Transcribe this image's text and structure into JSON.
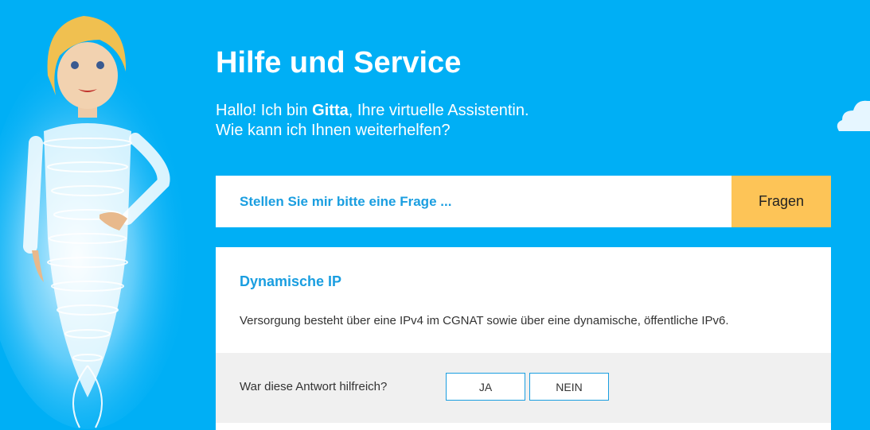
{
  "header": {
    "title": "Hilfe und Service",
    "intro_prefix": "Hallo! Ich bin ",
    "intro_name": "Gitta",
    "intro_suffix": ", Ihre virtuelle Assistentin.",
    "intro_line2": "Wie kann ich Ihnen weiterhelfen?"
  },
  "search": {
    "placeholder": "Stellen Sie mir bitte eine Frage ...",
    "button_label": "Fragen"
  },
  "answer": {
    "title": "Dynamische IP",
    "text": "Versorgung besteht über eine IPv4 im CGNAT sowie über eine dynamische, öffentliche IPv6.",
    "feedback_question": "War diese Antwort hilfreich?",
    "yes_label": "JA",
    "no_label": "NEIN"
  },
  "colors": {
    "background": "#00aff5",
    "accent": "#1a9ee0",
    "button": "#fdc457"
  }
}
